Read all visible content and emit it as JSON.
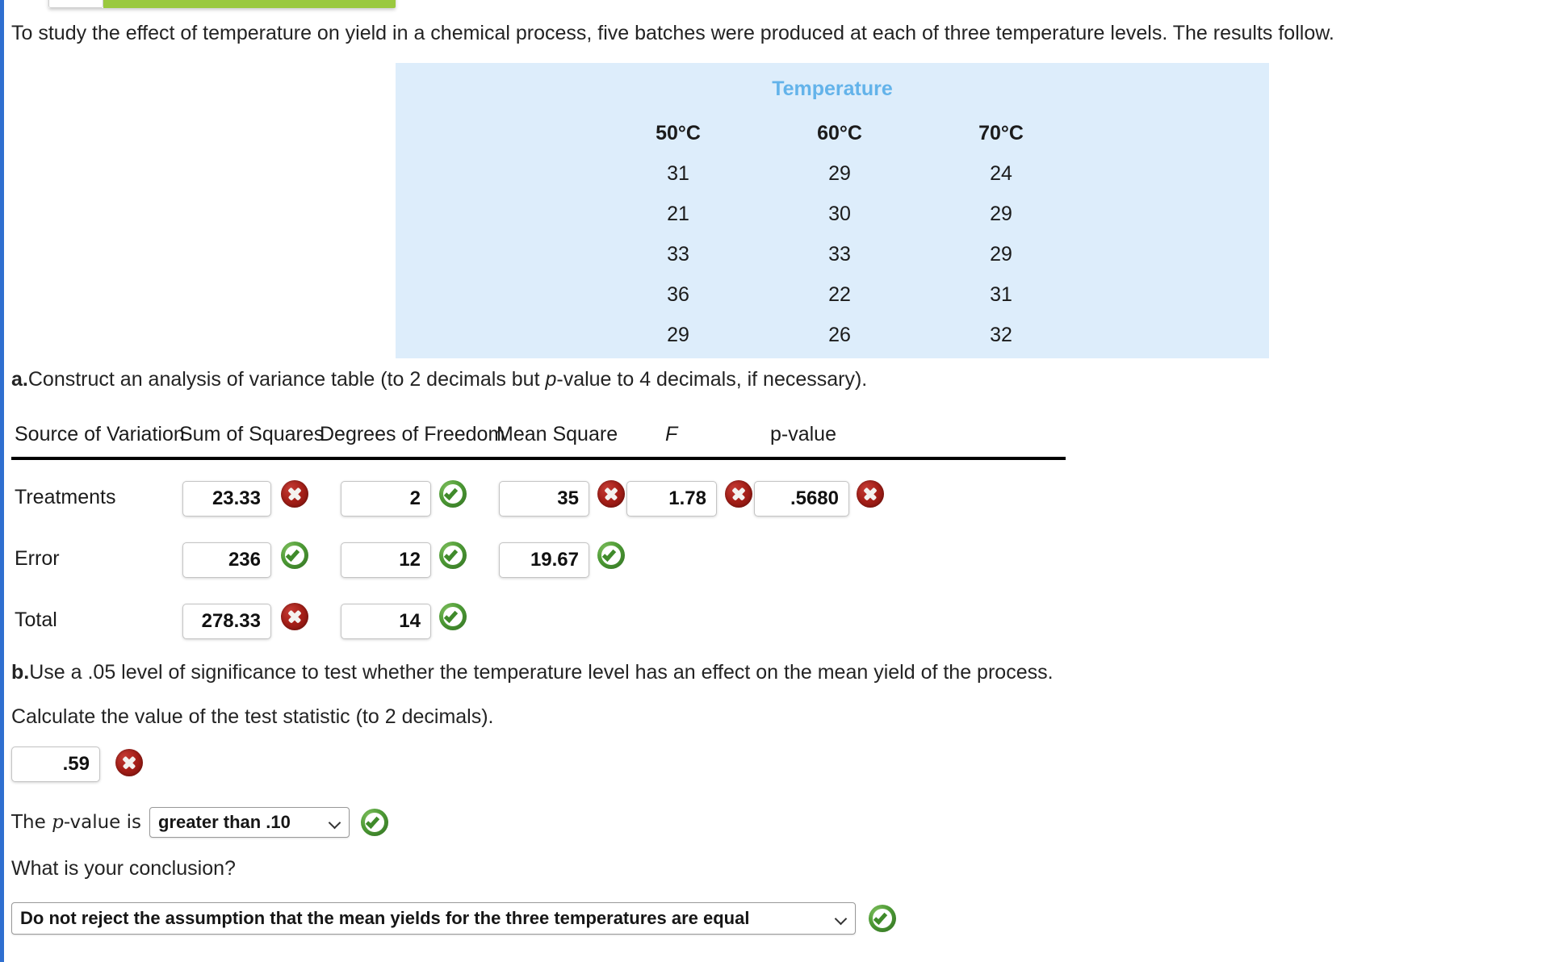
{
  "intro": {
    "sentence": "To study the effect of temperature on yield in a chemical process, five batches were produced at each of three temperature levels. The results follow."
  },
  "data_table": {
    "title": "Temperature",
    "columns": [
      "50°C",
      "60°C",
      "70°C"
    ],
    "rows": [
      [
        "31",
        "29",
        "24"
      ],
      [
        "21",
        "30",
        "29"
      ],
      [
        "33",
        "33",
        "29"
      ],
      [
        "36",
        "22",
        "31"
      ],
      [
        "29",
        "26",
        "32"
      ]
    ],
    "background_color": "#ddedfb",
    "title_color": "#63b3ea"
  },
  "part_a": {
    "prompt_marker": "a.",
    "prompt_text": "Construct an analysis of variance table (to 2 decimals but ",
    "prompt_italic": "p",
    "prompt_tail": "-value to 4 decimals, if necessary).",
    "table": {
      "headers": {
        "source": "Source of Variation",
        "ss": "Sum of Squares",
        "df": "Degrees of Freedom",
        "ms": "Mean Square",
        "f": "F",
        "p": "p-value"
      },
      "rows": [
        {
          "label": "Treatments",
          "ss": "23.33",
          "ss_status": "wrong",
          "df": "2",
          "df_status": "right",
          "ms": "35",
          "ms_status": "wrong",
          "f": "1.78",
          "f_status": "wrong",
          "p": ".5680",
          "p_status": "wrong"
        },
        {
          "label": "Error",
          "ss": "236",
          "ss_status": "right",
          "df": "12",
          "df_status": "right",
          "ms": "19.67",
          "ms_status": "right",
          "f": "",
          "f_status": "",
          "p": "",
          "p_status": ""
        },
        {
          "label": "Total",
          "ss": "278.33",
          "ss_status": "wrong",
          "df": "14",
          "df_status": "right",
          "ms": "",
          "ms_status": "",
          "f": "",
          "f_status": "",
          "p": "",
          "p_status": ""
        }
      ]
    }
  },
  "part_b": {
    "prompt_marker": "b.",
    "prompt_text": "Use a .05 level of significance to test whether the temperature level has an effect on the mean yield of the process.",
    "calc_text": "Calculate the value of the test statistic (to 2 decimals).",
    "test_statistic": {
      "value": ".59",
      "status": "wrong"
    },
    "pvalue": {
      "label_before": "The ",
      "label_italic": "p",
      "label_after": "-value is",
      "selected": "greater than .10",
      "status": "right"
    },
    "conclusion": {
      "question": "What is your conclusion?",
      "selected": "Do not reject the assumption that the mean yields for the three temperatures are equal",
      "status": "right"
    }
  },
  "chrome": {
    "rail_color": "#2f6fd0",
    "progress_color": "#9ac93f"
  }
}
